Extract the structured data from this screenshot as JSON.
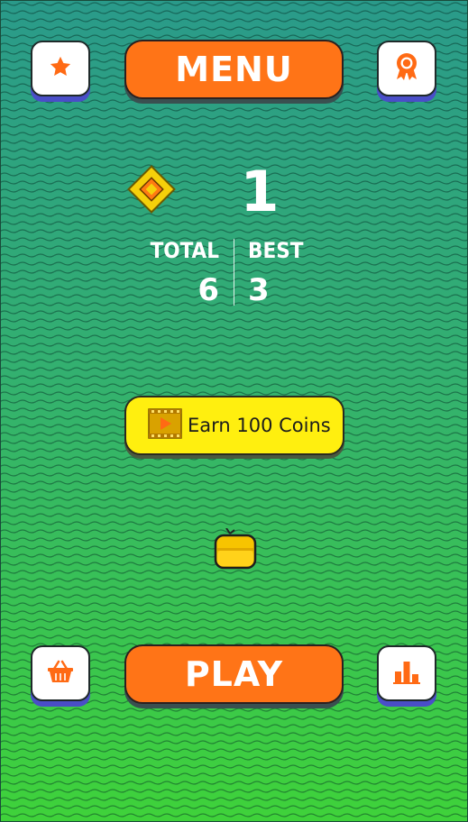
{
  "header": {
    "menu_label": "MENU"
  },
  "score": {
    "current": "1",
    "total_label": "TOTAL",
    "total_value": "6",
    "best_label": "BEST",
    "best_value": "3"
  },
  "reward": {
    "earn_label": "Earn 100 Coins"
  },
  "footer": {
    "play_label": "PLAY"
  },
  "icons": {
    "star": "star-icon",
    "ribbon": "award-ribbon-icon",
    "basket": "shop-basket-icon",
    "chart": "leaderboard-icon",
    "diamond": "diamond-coin-icon",
    "video": "video-film-icon",
    "player": "player-character-icon"
  },
  "colors": {
    "accent": "#ff7417",
    "yellow": "#ffef0f",
    "bg_top": "#2a9a8a",
    "bg_bottom": "#3fd23a"
  }
}
